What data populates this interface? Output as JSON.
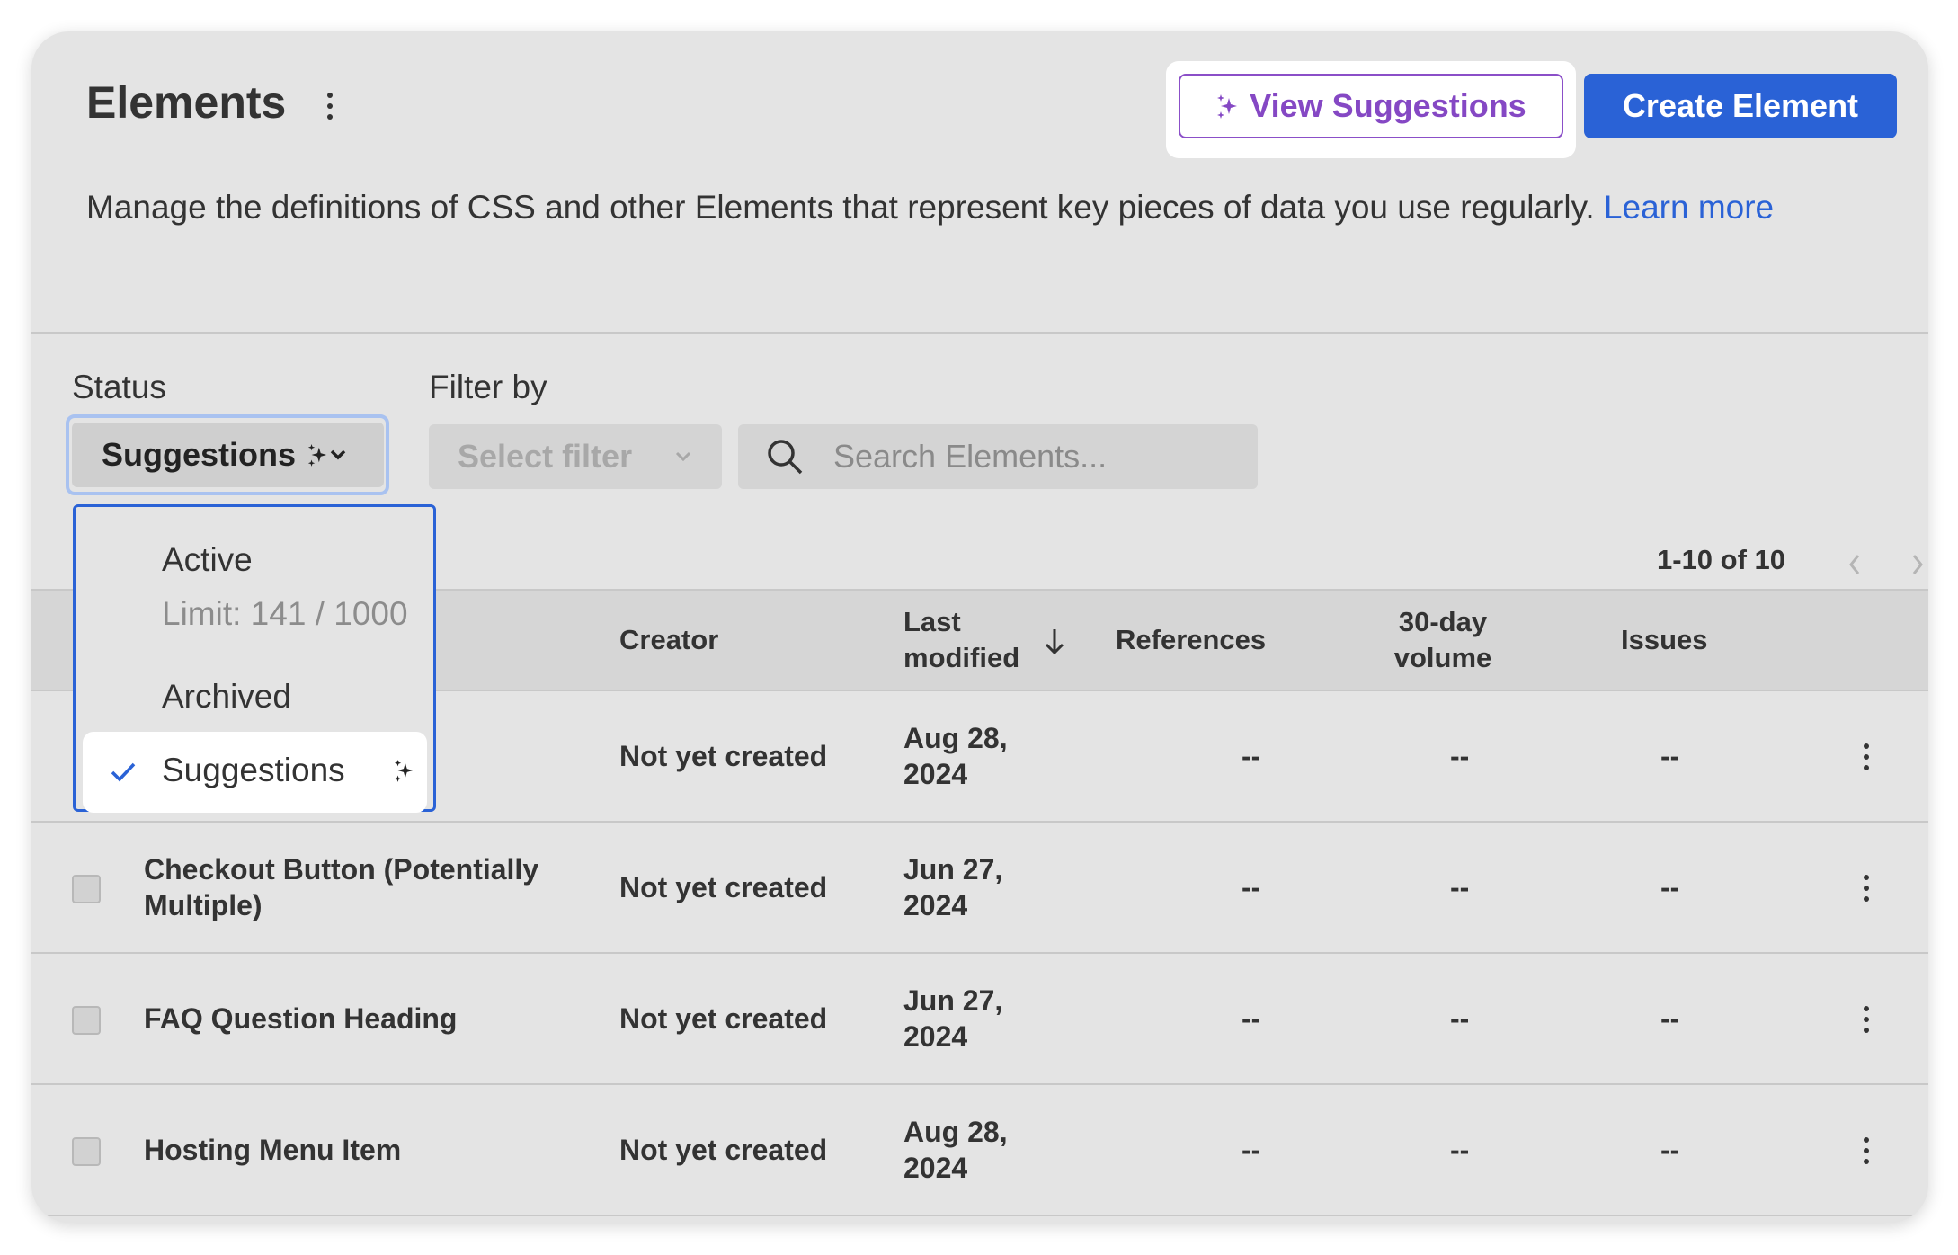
{
  "header": {
    "title": "Elements",
    "view_suggestions_label": "View Suggestions",
    "create_label": "Create Element",
    "description": "Manage the definitions of CSS and other Elements that represent key pieces of data you use regularly. ",
    "learn_more": "Learn more"
  },
  "filters": {
    "status_label": "Status",
    "status_value": "Suggestions",
    "filter_label": "Filter by",
    "filter_placeholder": "Select filter",
    "search_placeholder": "Search Elements..."
  },
  "dropdown": {
    "options": [
      {
        "label": "Active",
        "sub": "Limit: 141 / 1000"
      },
      {
        "label": "Archived"
      },
      {
        "label": "Suggestions",
        "selected": true
      }
    ]
  },
  "pagination": {
    "text": "1-10 of 10"
  },
  "table": {
    "headers": {
      "creator": "Creator",
      "last_modified_1": "Last",
      "last_modified_2": "modified",
      "references": "References",
      "volume_1": "30-day",
      "volume_2": "volume",
      "issues": "Issues"
    },
    "rows": [
      {
        "name": "",
        "creator": "Not yet created",
        "date_1": "Aug 28,",
        "date_2": "2024",
        "references": "--",
        "volume": "--",
        "issues": "--"
      },
      {
        "name_1": "Checkout Button (Potentially",
        "name_2": "Multiple)",
        "creator": "Not yet created",
        "date_1": "Jun 27,",
        "date_2": "2024",
        "references": "--",
        "volume": "--",
        "issues": "--"
      },
      {
        "name": "FAQ Question Heading",
        "creator": "Not yet created",
        "date_1": "Jun 27,",
        "date_2": "2024",
        "references": "--",
        "volume": "--",
        "issues": "--"
      },
      {
        "name": "Hosting Menu Item",
        "creator": "Not yet created",
        "date_1": "Aug 28,",
        "date_2": "2024",
        "references": "--",
        "volume": "--",
        "issues": "--"
      }
    ]
  },
  "colors": {
    "accent": "#2a62d6",
    "suggest_purple": "#8548c4",
    "card_bg": "#e4e4e4"
  },
  "icons": {
    "sparkle": "sparkle-icon",
    "chevron": "chevron-down-icon",
    "search": "search-icon",
    "check": "check-icon",
    "sort": "arrow-down-icon",
    "more": "more-vertical-icon"
  }
}
